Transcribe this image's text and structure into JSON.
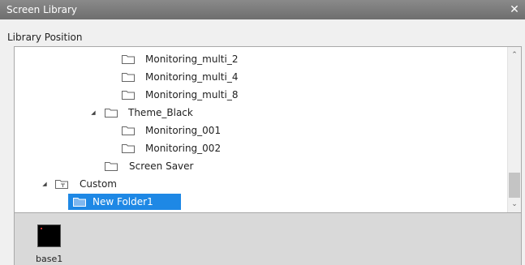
{
  "window": {
    "title": "Screen Library",
    "close_glyph": "✕"
  },
  "library_position_label": "Library Position",
  "tree": {
    "nodes": [
      {
        "label": "Monitoring_multi_2",
        "icon": "folder-icon"
      },
      {
        "label": "Monitoring_multi_4",
        "icon": "folder-icon"
      },
      {
        "label": "Monitoring_multi_8",
        "icon": "folder-icon"
      },
      {
        "label": "Theme_Black",
        "icon": "folder-icon",
        "expanded": true
      },
      {
        "label": "Monitoring_001",
        "icon": "folder-icon"
      },
      {
        "label": "Monitoring_002",
        "icon": "folder-icon"
      },
      {
        "label": "Screen Saver",
        "icon": "folder-icon"
      },
      {
        "label": "Custom",
        "icon": "custom-folder-icon",
        "expanded": true
      },
      {
        "label": "New Folder1",
        "icon": "folder-open-icon",
        "selected": true
      }
    ],
    "expand_glyph": "◢"
  },
  "scrollbar": {
    "up_glyph": "⌃",
    "down_glyph": "⌄"
  },
  "preview": {
    "items": [
      {
        "label": "base1"
      }
    ]
  },
  "colors": {
    "selection": "#1e88e5",
    "titlebar": "#7a7a7a",
    "preview_bg": "#d9d9d9"
  }
}
